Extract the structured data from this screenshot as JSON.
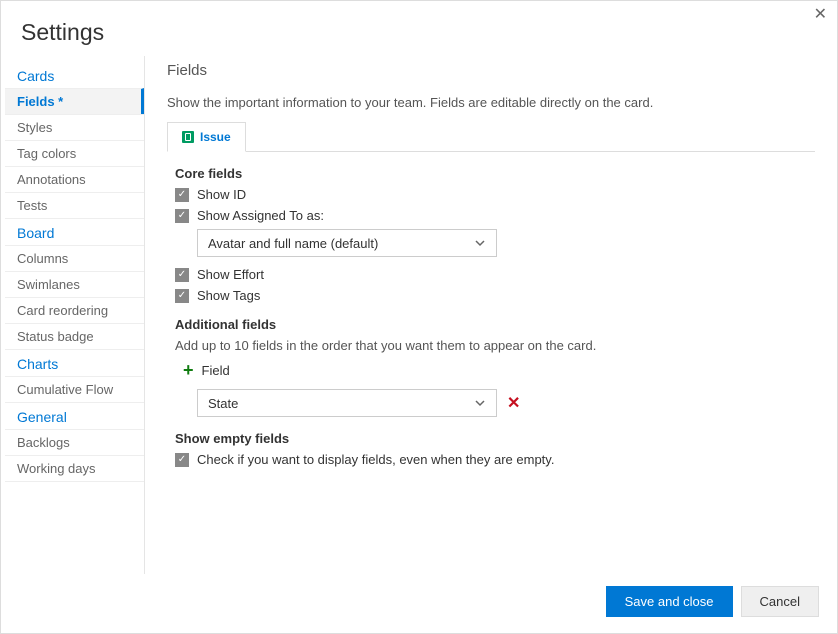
{
  "title": "Settings",
  "sidebar": {
    "groups": [
      {
        "header": "Cards",
        "items": [
          {
            "label": "Fields *",
            "selected": true
          },
          {
            "label": "Styles"
          },
          {
            "label": "Tag colors"
          },
          {
            "label": "Annotations"
          },
          {
            "label": "Tests"
          }
        ]
      },
      {
        "header": "Board",
        "items": [
          {
            "label": "Columns"
          },
          {
            "label": "Swimlanes"
          },
          {
            "label": "Card reordering"
          },
          {
            "label": "Status badge"
          }
        ]
      },
      {
        "header": "Charts",
        "items": [
          {
            "label": "Cumulative Flow"
          }
        ]
      },
      {
        "header": "General",
        "items": [
          {
            "label": "Backlogs"
          },
          {
            "label": "Working days"
          }
        ]
      }
    ]
  },
  "main": {
    "heading": "Fields",
    "description": "Show the important information to your team. Fields are editable directly on the card.",
    "tab": {
      "label": "Issue"
    },
    "core": {
      "header": "Core fields",
      "showId": {
        "label": "Show ID",
        "checked": true
      },
      "showAssigned": {
        "label": "Show Assigned To as:",
        "checked": true
      },
      "assignedSelect": {
        "value": "Avatar and full name (default)"
      },
      "showEffort": {
        "label": "Show Effort",
        "checked": true
      },
      "showTags": {
        "label": "Show Tags",
        "checked": true
      }
    },
    "additional": {
      "header": "Additional fields",
      "desc": "Add up to 10 fields in the order that you want them to appear on the card.",
      "addLabel": "Field",
      "rows": [
        {
          "value": "State"
        }
      ]
    },
    "empty": {
      "header": "Show empty fields",
      "checkbox": {
        "label": "Check if you want to display fields, even when they are empty.",
        "checked": true
      }
    }
  },
  "footer": {
    "save": "Save and close",
    "cancel": "Cancel"
  }
}
